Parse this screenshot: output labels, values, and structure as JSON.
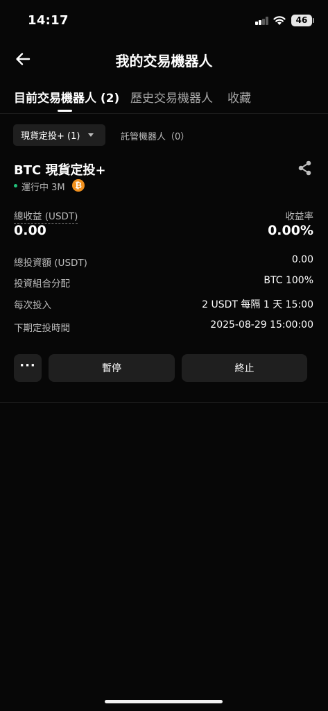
{
  "status_bar": {
    "time": "14:17",
    "battery": "46"
  },
  "header": {
    "title": "我的交易機器人"
  },
  "tabs": [
    {
      "label": "目前交易機器人 (2)",
      "active": true
    },
    {
      "label": "歷史交易機器人",
      "active": false
    },
    {
      "label": "收藏",
      "active": false
    }
  ],
  "filters": {
    "selected": "現貨定投+ (1)",
    "other": "託管機器人（0）"
  },
  "bot": {
    "name": "BTC 現貨定投+",
    "status": "運行中 3M",
    "coin_icon": "₿",
    "total_profit_label": "總收益 (USDT)",
    "total_profit_value": "0.00",
    "profit_rate_label": "收益率",
    "profit_rate_value": "0.00%",
    "details": [
      {
        "label": "總投資額 (USDT)",
        "value": "0.00"
      },
      {
        "label": "投資組合分配",
        "value": "BTC 100%"
      },
      {
        "label": "每次投入",
        "value": "2 USDT 每隔 1 天 15:00"
      },
      {
        "label": "下期定投時間",
        "value": "2025-08-29 15:00:00"
      }
    ]
  },
  "actions": {
    "more": "···",
    "pause": "暫停",
    "stop": "終止"
  },
  "colors": {
    "background": "#070707",
    "accent_green": "#22c07a",
    "btc_orange": "#f0901e"
  }
}
